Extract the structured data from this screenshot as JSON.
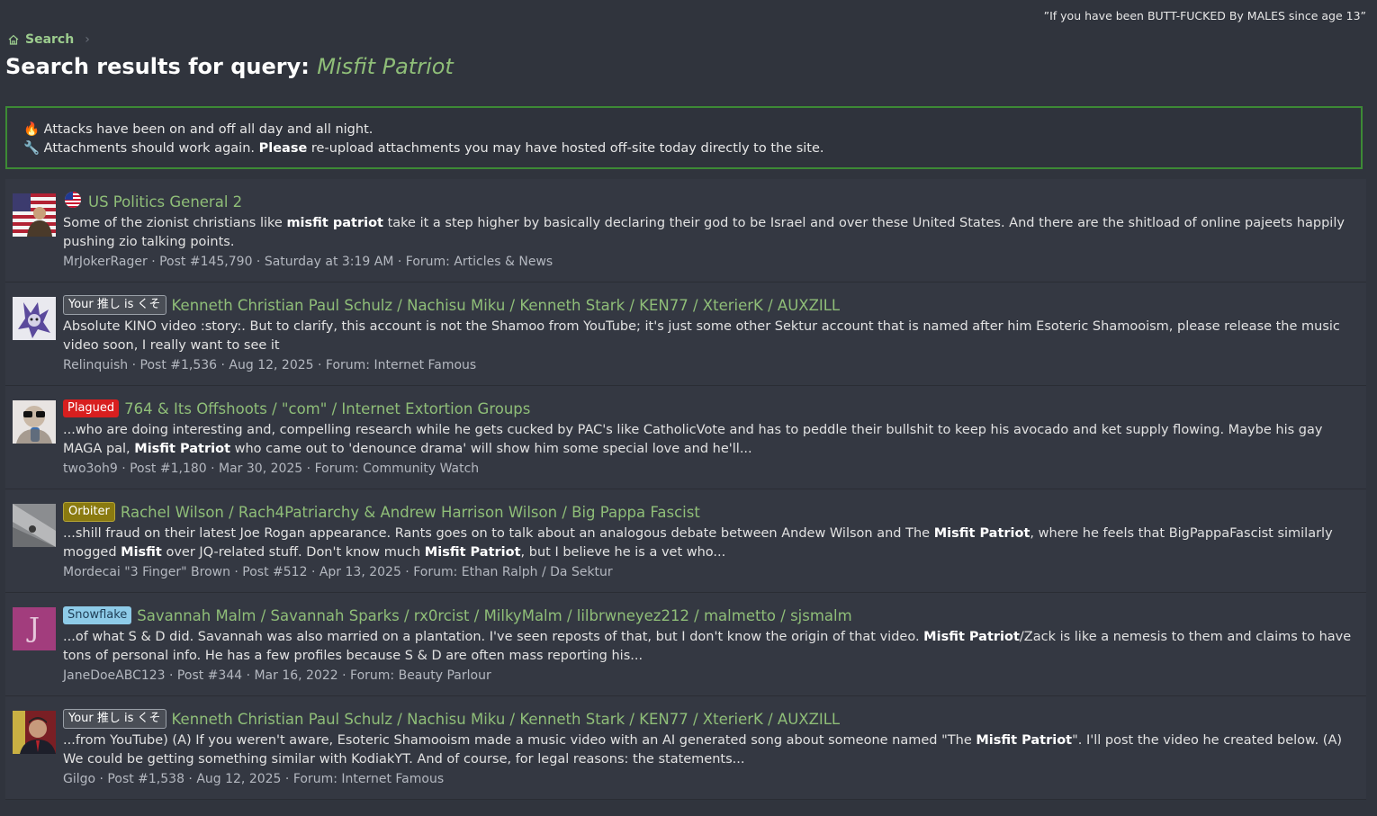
{
  "header": {
    "quote": "”If you have been BUTT-FUCKED By MALES since age 13”"
  },
  "breadcrumb": {
    "label": "Search"
  },
  "page": {
    "title_prefix": "Search results for query:",
    "query": "Misfit Patriot"
  },
  "notice": {
    "line1": "Attacks have been on and off all day and all night.",
    "line2_pre": "Attachments should work again.",
    "line2_bold": "Please",
    "line2_post": "re-upload attachments you may have hosted off-site today directly to the site."
  },
  "results": [
    {
      "title": "US Politics General 2",
      "snippet": [
        [
          "Some of the zionist christians like ",
          0
        ],
        [
          "misfit patriot",
          1
        ],
        [
          " take it a step higher by basically declaring their god to be Israel and over these United States. And there are the shitload of online pajeets happily pushing zio talking points.",
          0
        ]
      ],
      "meta": "MrJokerRager · Post #145,790 · Saturday at 3:19 AM · Forum: Articles & News"
    },
    {
      "badge": "Your 推し is くそ",
      "title": "Kenneth Christian Paul Schulz / Nachisu Miku / Kenneth Stark / KEN77 / XterierK / AUXZILL",
      "snippet": [
        [
          "Absolute KINO video :story:. But to clarify, this account is not the Shamoo from YouTube; it's just some other Sektur account that is named after him Esoteric Shamooism, please release the music video soon, I really want to see it",
          0
        ]
      ],
      "meta": "Relinquish · Post #1,536 · Aug 12, 2025 · Forum: Internet Famous"
    },
    {
      "badge": "Plagued",
      "title": "764 & Its Offshoots / \"com\" / Internet Extortion Groups",
      "snippet": [
        [
          "...who are doing interesting and, compelling research while he gets cucked by PAC's like CatholicVote and has to peddle their bullshit to keep his avocado and ket supply flowing. Maybe his gay MAGA pal, ",
          0
        ],
        [
          "Misfit Patriot",
          1
        ],
        [
          " who came out to 'denounce drama' will show him some special love and he'll...",
          0
        ]
      ],
      "meta": "two3oh9 · Post #1,180 · Mar 30, 2025 · Forum: Community Watch"
    },
    {
      "badge": "Orbiter",
      "title": "Rachel Wilson / Rach4Patriarchy & Andrew Harrison Wilson / Big Pappa Fascist",
      "snippet": [
        [
          "...shill fraud on their latest Joe Rogan appearance. Rants goes on to talk about an analogous debate between Andew Wilson and The ",
          0
        ],
        [
          "Misfit Patriot",
          1
        ],
        [
          ", where he feels that BigPappaFascist similarly mogged ",
          0
        ],
        [
          "Misfit",
          1
        ],
        [
          " over JQ-related stuff. Don't know much ",
          0
        ],
        [
          "Misfit Patriot",
          1
        ],
        [
          ", but I believe he is a vet who...",
          0
        ]
      ],
      "meta": "Mordecai \"3 Finger\" Brown · Post #512 · Apr 13, 2025 · Forum: Ethan Ralph / Da Sektur"
    },
    {
      "badge": "Snowflake",
      "avatar_letter": "J",
      "title": "Savannah Malm / Savannah Sparks / rx0rcist / MilkyMalm / lilbrwneyez212 / malmetto / sjsmalm",
      "snippet": [
        [
          "...of what S & D did. Savannah was also married on a plantation. I've seen reposts of that, but I don't know the origin of that video. ",
          0
        ],
        [
          "Misfit Patriot",
          1
        ],
        [
          "/Zack is like a nemesis to them and claims to have tons of personal info. He has a few profiles because S & D are often mass reporting his...",
          0
        ]
      ],
      "meta": "JaneDoeABC123 · Post #344 · Mar 16, 2022 · Forum: Beauty Parlour"
    },
    {
      "badge": "Your 推し is くそ",
      "title": "Kenneth Christian Paul Schulz / Nachisu Miku / Kenneth Stark / KEN77 / XterierK / AUXZILL",
      "snippet": [
        [
          "...from YouTube) (A) If you weren't aware, Esoteric Shamooism made a music video with an AI generated song about someone named \"The ",
          0
        ],
        [
          "Misfit Patriot",
          1
        ],
        [
          "\". I'll post the video he created below. (A) We could be getting something similar with KodiakYT. And of course, for legal reasons: the statements...",
          0
        ]
      ],
      "meta": "Gilgo · Post #1,538 · Aug 12, 2025 · Forum: Internet Famous"
    }
  ]
}
